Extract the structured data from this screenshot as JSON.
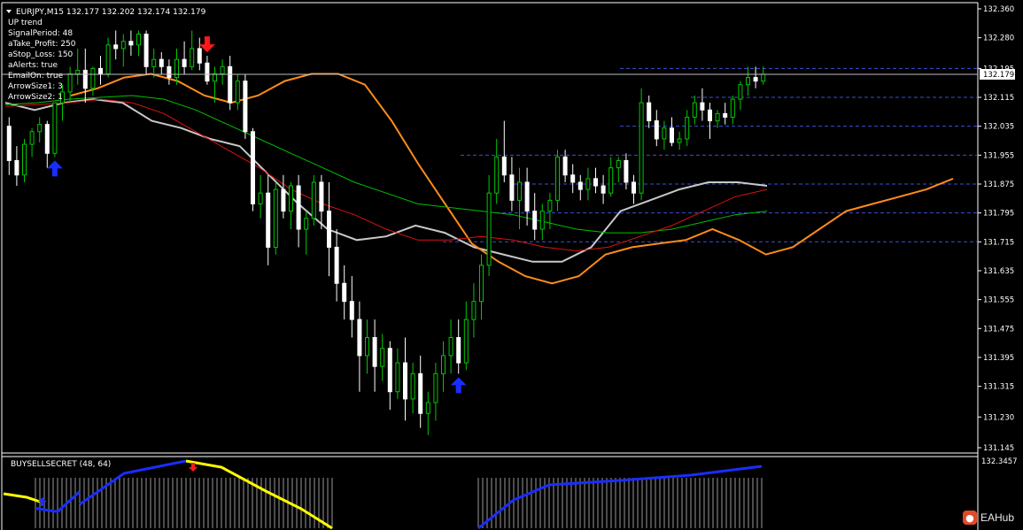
{
  "window": {
    "symbol_line": "EURJPY,M15  132.177 132.202 132.174 132.179"
  },
  "indicator_info": {
    "lines": [
      "UP trend",
      "SignalPeriod: 48",
      "aTake_Profit: 250",
      "aStop_Loss: 150",
      "aAlerts: true",
      "EmailOn: true",
      "ArrowSize1: 3",
      "ArrowSize2: 1"
    ]
  },
  "price_axis": {
    "labels": [
      "132.360",
      "132.280",
      "132.195",
      "132.115",
      "132.035",
      "131.955",
      "131.875",
      "131.795",
      "131.715",
      "131.635",
      "131.555",
      "131.475",
      "131.395",
      "131.315",
      "131.230",
      "131.145"
    ],
    "current_price": "132.179"
  },
  "sub_window": {
    "title": "BUYSELLSECRET (48, 64)",
    "axis_label": "132.3457"
  },
  "watermark": {
    "text": "EAHub",
    "icon": "eahub-logo-icon"
  },
  "colors": {
    "background": "#000000",
    "bull_candle": "#00c800",
    "bear_candle": "#ffffff",
    "ma_green": "#00c000",
    "ma_red": "#e01010",
    "band_orange": "#ff8c1a",
    "band_silver": "#c8c8c8",
    "level_blue": "#3d4fd6",
    "osc_blue": "#1a2dff",
    "osc_yellow": "#ffff00",
    "arrow_up": "#1a2dff",
    "arrow_down": "#ff1a1a"
  },
  "chart_data": {
    "type": "candlestick",
    "symbol": "EURJPY",
    "timeframe": "M15",
    "ylim": [
      131.145,
      132.36
    ],
    "candles": [
      [
        132.035,
        132.06,
        131.9,
        131.94
      ],
      [
        131.94,
        131.98,
        131.87,
        131.9
      ],
      [
        131.9,
        132.0,
        131.88,
        131.985
      ],
      [
        131.985,
        132.03,
        131.95,
        132.02
      ],
      [
        132.02,
        132.06,
        131.99,
        132.04
      ],
      [
        132.04,
        132.05,
        131.92,
        131.96
      ],
      [
        131.96,
        132.1,
        131.95,
        132.1
      ],
      [
        132.1,
        132.15,
        132.05,
        132.13
      ],
      [
        132.13,
        132.2,
        132.1,
        132.18
      ],
      [
        132.18,
        132.25,
        132.15,
        132.19
      ],
      [
        132.19,
        132.25,
        132.1,
        132.14
      ],
      [
        132.14,
        132.2,
        132.12,
        132.195
      ],
      [
        132.195,
        132.23,
        132.15,
        132.18
      ],
      [
        132.18,
        132.28,
        132.17,
        132.26
      ],
      [
        132.26,
        132.3,
        132.22,
        132.25
      ],
      [
        132.25,
        132.29,
        132.2,
        132.27
      ],
      [
        132.27,
        132.3,
        132.23,
        132.26
      ],
      [
        132.26,
        132.3,
        132.23,
        132.29
      ],
      [
        132.29,
        132.3,
        132.18,
        132.2
      ],
      [
        132.2,
        132.25,
        132.17,
        132.22
      ],
      [
        132.22,
        132.24,
        132.18,
        132.2
      ],
      [
        132.2,
        132.22,
        132.15,
        132.17
      ],
      [
        132.17,
        132.25,
        132.15,
        132.22
      ],
      [
        132.22,
        132.27,
        132.18,
        132.2
      ],
      [
        132.2,
        132.3,
        132.19,
        132.25
      ],
      [
        132.25,
        132.28,
        132.19,
        132.21
      ],
      [
        132.21,
        132.23,
        132.15,
        132.16
      ],
      [
        132.16,
        132.2,
        132.1,
        132.18
      ],
      [
        132.18,
        132.22,
        132.15,
        132.2
      ],
      [
        132.2,
        132.23,
        132.08,
        132.1
      ],
      [
        132.1,
        132.18,
        132.08,
        132.16
      ],
      [
        132.16,
        132.18,
        132.0,
        132.02
      ],
      [
        132.02,
        132.03,
        131.8,
        131.82
      ],
      [
        131.82,
        131.9,
        131.78,
        131.85
      ],
      [
        131.85,
        131.9,
        131.65,
        131.7
      ],
      [
        131.7,
        131.88,
        131.68,
        131.86
      ],
      [
        131.86,
        131.9,
        131.78,
        131.8
      ],
      [
        131.8,
        131.88,
        131.75,
        131.87
      ],
      [
        131.87,
        131.9,
        131.7,
        131.75
      ],
      [
        131.75,
        131.8,
        131.68,
        131.78
      ],
      [
        131.78,
        131.9,
        131.76,
        131.88
      ],
      [
        131.88,
        131.9,
        131.75,
        131.8
      ],
      [
        131.8,
        131.88,
        131.62,
        131.7
      ],
      [
        131.7,
        131.75,
        131.55,
        131.6
      ],
      [
        131.6,
        131.65,
        131.5,
        131.55
      ],
      [
        131.55,
        131.62,
        131.45,
        131.5
      ],
      [
        131.5,
        131.55,
        131.3,
        131.4
      ],
      [
        131.4,
        131.5,
        131.35,
        131.45
      ],
      [
        131.45,
        131.5,
        131.3,
        131.37
      ],
      [
        131.37,
        131.46,
        131.33,
        131.42
      ],
      [
        131.42,
        131.44,
        131.25,
        131.3
      ],
      [
        131.3,
        131.42,
        131.28,
        131.38
      ],
      [
        131.38,
        131.45,
        131.22,
        131.28
      ],
      [
        131.28,
        131.38,
        131.24,
        131.35
      ],
      [
        131.35,
        131.4,
        131.2,
        131.24
      ],
      [
        131.24,
        131.3,
        131.18,
        131.27
      ],
      [
        131.27,
        131.38,
        131.22,
        131.35
      ],
      [
        131.35,
        131.44,
        131.3,
        131.4
      ],
      [
        131.4,
        131.5,
        131.35,
        131.45
      ],
      [
        131.45,
        131.5,
        131.35,
        131.38
      ],
      [
        131.38,
        131.55,
        131.36,
        131.5
      ],
      [
        131.5,
        131.6,
        131.45,
        131.55
      ],
      [
        131.55,
        131.68,
        131.5,
        131.65
      ],
      [
        131.65,
        131.9,
        131.62,
        131.85
      ],
      [
        131.85,
        132.0,
        131.82,
        131.95
      ],
      [
        131.95,
        132.05,
        131.88,
        131.9
      ],
      [
        131.9,
        131.95,
        131.8,
        131.83
      ],
      [
        131.83,
        131.92,
        131.75,
        131.88
      ],
      [
        131.88,
        131.92,
        131.76,
        131.8
      ],
      [
        131.8,
        131.85,
        131.72,
        131.75
      ],
      [
        131.75,
        131.82,
        131.72,
        131.8
      ],
      [
        131.8,
        131.85,
        131.75,
        131.83
      ],
      [
        131.83,
        131.97,
        131.8,
        131.95
      ],
      [
        131.95,
        131.97,
        131.88,
        131.9
      ],
      [
        131.9,
        131.93,
        131.85,
        131.88
      ],
      [
        131.88,
        131.9,
        131.83,
        131.86
      ],
      [
        131.86,
        131.92,
        131.83,
        131.89
      ],
      [
        131.89,
        131.92,
        131.85,
        131.87
      ],
      [
        131.87,
        131.9,
        131.82,
        131.85
      ],
      [
        131.85,
        131.95,
        131.84,
        131.92
      ],
      [
        131.92,
        131.95,
        131.88,
        131.94
      ],
      [
        131.94,
        131.96,
        131.86,
        131.88
      ],
      [
        131.88,
        131.9,
        131.82,
        131.85
      ],
      [
        131.85,
        132.14,
        131.83,
        132.1
      ],
      [
        132.1,
        132.12,
        132.03,
        132.05
      ],
      [
        132.05,
        132.08,
        131.98,
        132.0
      ],
      [
        132.0,
        132.05,
        131.97,
        132.03
      ],
      [
        132.03,
        132.06,
        131.98,
        131.99
      ],
      [
        131.99,
        132.02,
        131.97,
        132.0
      ],
      [
        132.0,
        132.08,
        131.98,
        132.06
      ],
      [
        132.06,
        132.12,
        132.04,
        132.1
      ],
      [
        132.1,
        132.14,
        132.05,
        132.08
      ],
      [
        132.08,
        132.1,
        132.0,
        132.05
      ],
      [
        132.05,
        132.08,
        132.03,
        132.07
      ],
      [
        132.07,
        132.1,
        132.04,
        132.06
      ],
      [
        132.06,
        132.12,
        132.04,
        132.11
      ],
      [
        132.11,
        132.16,
        132.08,
        132.15
      ],
      [
        132.15,
        132.2,
        132.12,
        132.17
      ],
      [
        132.17,
        132.2,
        132.14,
        132.16
      ],
      [
        132.16,
        132.2,
        132.15,
        132.179
      ]
    ],
    "ma_green": [
      132.095,
      132.1,
      132.11,
      132.115,
      132.12,
      132.11,
      132.08,
      132.04,
      132.0,
      131.96,
      131.92,
      131.88,
      131.85,
      131.82,
      131.81,
      131.8,
      131.79,
      131.77,
      131.75,
      131.74,
      131.74,
      131.75,
      131.77,
      131.79,
      131.8
    ],
    "ma_red": [
      132.09,
      132.095,
      132.1,
      132.11,
      132.1,
      132.07,
      132.02,
      131.97,
      131.92,
      131.86,
      131.82,
      131.79,
      131.75,
      131.72,
      131.72,
      131.73,
      131.72,
      131.7,
      131.69,
      131.7,
      131.73,
      131.76,
      131.8,
      131.84,
      131.86
    ],
    "band_orange": [
      132.12,
      132.14,
      132.17,
      132.18,
      132.16,
      132.12,
      132.1,
      132.12,
      132.16,
      132.18,
      132.18,
      132.15,
      132.05,
      131.93,
      131.82,
      131.71,
      131.66,
      131.62,
      131.6,
      131.62,
      131.68,
      131.7,
      131.71,
      131.72,
      131.75,
      131.72,
      131.68,
      131.7,
      131.75,
      131.8,
      131.82,
      131.84,
      131.86,
      131.89
    ],
    "band_silver": [
      132.1,
      132.08,
      132.1,
      132.11,
      132.1,
      132.05,
      132.03,
      132.0,
      131.98,
      131.9,
      131.82,
      131.75,
      131.72,
      131.73,
      131.76,
      131.74,
      131.7,
      131.68,
      131.66,
      131.66,
      131.7,
      131.8,
      131.83,
      131.86,
      131.88,
      131.88,
      131.87
    ],
    "levels": [
      "132.195",
      "132.115",
      "132.035",
      "131.955",
      "131.875",
      "131.795",
      "131.715"
    ],
    "signals": [
      {
        "type": "buy",
        "candle": 6
      },
      {
        "type": "sell",
        "candle": 26
      },
      {
        "type": "buy",
        "candle": 59
      }
    ],
    "oscillator": {
      "blue": [
        0.3,
        0.25,
        0.55,
        0.78,
        0.92,
        0.98,
        1.0
      ],
      "yellow": [
        0.98,
        0.93,
        0.8,
        0.6,
        0.35,
        0.1
      ]
    }
  }
}
